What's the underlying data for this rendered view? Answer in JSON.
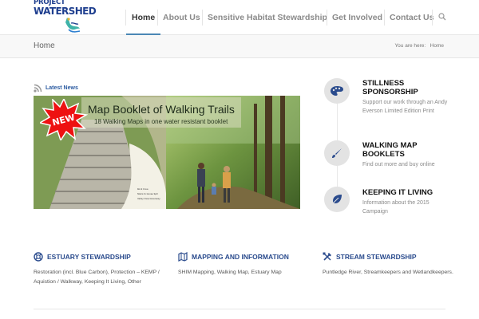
{
  "header": {
    "logo_line1": "PROJECT",
    "logo_line2": "WATERSHED",
    "nav": [
      {
        "label": "Home",
        "active": true
      },
      {
        "label": "About Us",
        "active": false
      },
      {
        "label": "Sensitive Habitat Stewardship",
        "active": false
      },
      {
        "label": "Get Involved",
        "active": false
      },
      {
        "label": "Contact Us",
        "active": false
      }
    ],
    "search_icon": "search-icon"
  },
  "titlebar": {
    "title": "Home",
    "breadcrumb_prefix": "You are here:",
    "breadcrumb_current": "Home"
  },
  "news": {
    "label": "Latest News",
    "banner_title": "Map Booklet of Walking Trails",
    "banner_subtitle": "18 Walking Maps in one water resistant booklet",
    "badge": "NEW"
  },
  "features": [
    {
      "icon": "palette-icon",
      "title": "STILLNESS SPONSORSHIP",
      "desc": "Support our work through an Andy Everson Limited Edition Print"
    },
    {
      "icon": "brush-icon",
      "title": "WALKING MAP BOOKLETS",
      "desc": "Find out more and buy online"
    },
    {
      "icon": "leaf-icon",
      "title": "KEEPING IT LIVING",
      "desc": "Information about the 2015 Campaign"
    }
  ],
  "columns": [
    {
      "icon": "lifebuoy-icon",
      "title": "ESTUARY STEWARDSHIP",
      "desc": "Restoration (incl. Blue Carbon), Protection – KEMP / Aquistion / Walkway, Keeping It Living, Other"
    },
    {
      "icon": "map-icon",
      "title": "MAPPING AND INFORMATION",
      "desc": "SHIM Mapping, Walking Map, Estuary Map"
    },
    {
      "icon": "tools-icon",
      "title": "STREAM STEWARDSHIP",
      "desc": "Puntledge River, Streamkeepers and Wetlandkeepers."
    }
  ],
  "colors": {
    "accent": "#4b87b5",
    "heading_blue": "#2a4b8d",
    "nav_text": "#8a8a8a"
  }
}
